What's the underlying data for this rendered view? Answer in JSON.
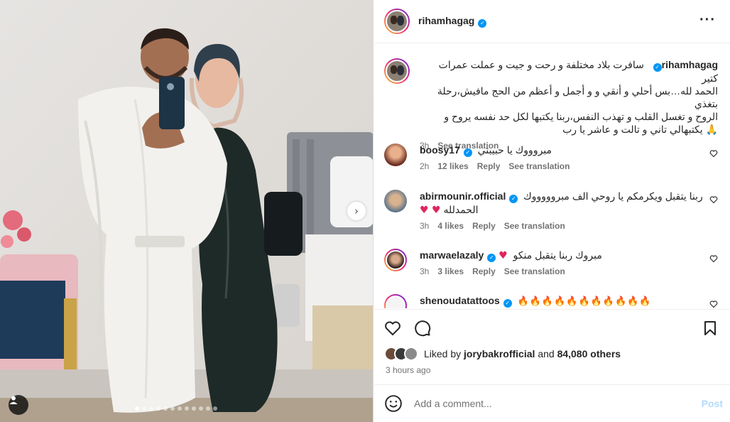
{
  "post": {
    "author": "rihamhagag",
    "caption_lines": [
      "سافرت بلاد مختلفة و رحت و جيت و عملت عمرات كتير",
      "الحمد لله…بس أحلي و أنقي و و أجمل و أعظم من الحج مافيش،رحلة بتغذي",
      "الروح و تغسل القلب و تهذب النفس،ربنا يكتبها لكل حد نفسه يروح و",
      "يكتبهالي تاني و تالت و عاشر يا رب"
    ],
    "caption_time": "3h",
    "see_translation": "See translation"
  },
  "comments": [
    {
      "user": "boosy17",
      "text": "مبروووك يا حبيبتي",
      "time": "2h",
      "likes": "12 likes",
      "reply": "Reply",
      "translate": "See translation"
    },
    {
      "user": "abirmounir.official",
      "text": "ربنا يتقبل ويكرمكم يا روحي الف مبروووووك",
      "text2": "الحمدلله",
      "time": "3h",
      "likes": "4 likes",
      "reply": "Reply",
      "translate": "See translation"
    },
    {
      "user": "marwaelazaly",
      "text": "مبروك ربنا يتقبل منكو",
      "time": "3h",
      "likes": "3 likes",
      "reply": "Reply",
      "translate": "See translation"
    },
    {
      "user": "shenoudatattoos",
      "text": ""
    }
  ],
  "likes": {
    "prefix": "Liked by",
    "user": "jorybakrofficial",
    "and": "and",
    "count": "84,080 others"
  },
  "timestamp": "3 hours ago",
  "add_comment": {
    "placeholder": "Add a comment...",
    "post_label": "Post"
  },
  "icons": {
    "more": "more-options-icon",
    "like": "heart-icon",
    "comment": "comment-icon",
    "save": "bookmark-icon",
    "emoji": "emoji-icon",
    "next": "chevron-right-icon",
    "tag": "user-tag-icon"
  },
  "colors": {
    "verified": "#0095f6",
    "link_muted": "#737373",
    "post_disabled": "#b3dbff",
    "heart_red": "#e0245e"
  }
}
